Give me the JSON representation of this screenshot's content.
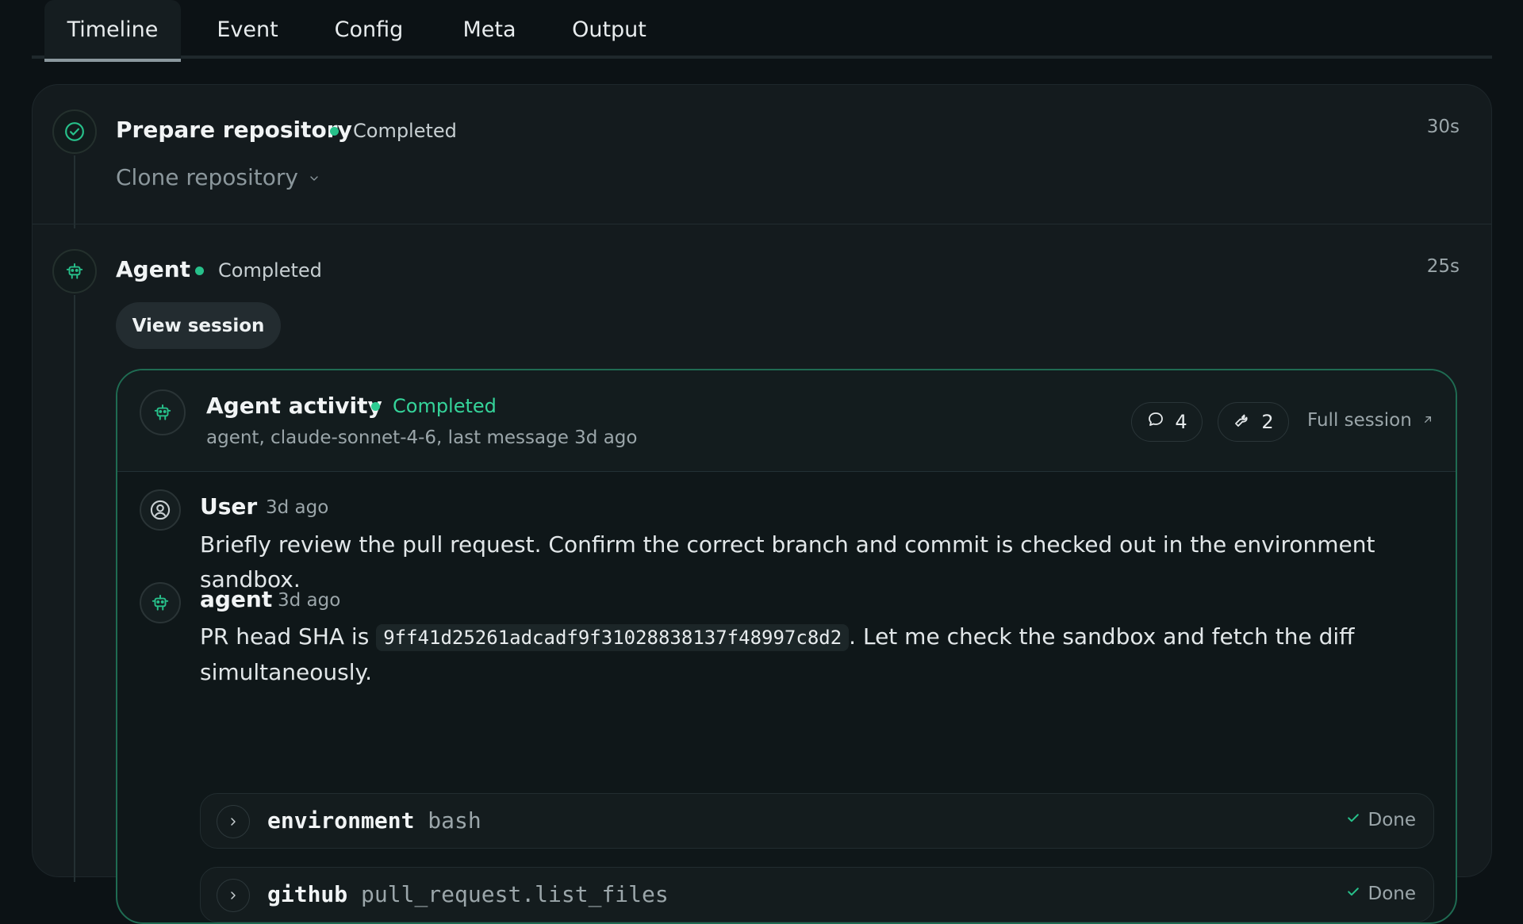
{
  "tabs": [
    {
      "label": "Timeline",
      "active": true
    },
    {
      "label": "Event",
      "active": false
    },
    {
      "label": "Config",
      "active": false
    },
    {
      "label": "Meta",
      "active": false
    },
    {
      "label": "Output",
      "active": false
    }
  ],
  "steps": {
    "prepare": {
      "title": "Prepare repository",
      "status": "Completed",
      "duration": "30s",
      "substep": "Clone repository",
      "icon": "check-circle-icon"
    },
    "agent": {
      "title": "Agent",
      "status": "Completed",
      "duration": "25s",
      "view_session_label": "View session",
      "icon": "robot-icon"
    }
  },
  "activity": {
    "title": "Agent activity",
    "status": "Completed",
    "subtitle": "agent, claude-sonnet-4-6, last message 3d ago",
    "message_count": "4",
    "tool_count": "2",
    "full_session_label": "Full session"
  },
  "messages": [
    {
      "author": "User",
      "time": "3d ago",
      "text": "Briefly review the pull request. Confirm the correct branch and commit is checked out in the environment sandbox.",
      "icon": "user-circle-icon"
    },
    {
      "author": "agent",
      "time": "3d ago",
      "text_before": "PR head SHA is",
      "code": "9ff41d25261adcadf9f31028838137f48997c8d2",
      "text_after": ". Let me check the sandbox and fetch the diff",
      "text_line2": "simultaneously.",
      "icon": "robot-icon"
    }
  ],
  "tools": [
    {
      "name": "environment",
      "method": "bash",
      "status": "Done"
    },
    {
      "name": "github",
      "method": "pull_request.list_files",
      "status": "Done"
    }
  ],
  "colors": {
    "background": "#0c1215",
    "panel": "#141b1e",
    "accent_green": "#27c08a",
    "activity_border": "#1f6b52"
  }
}
